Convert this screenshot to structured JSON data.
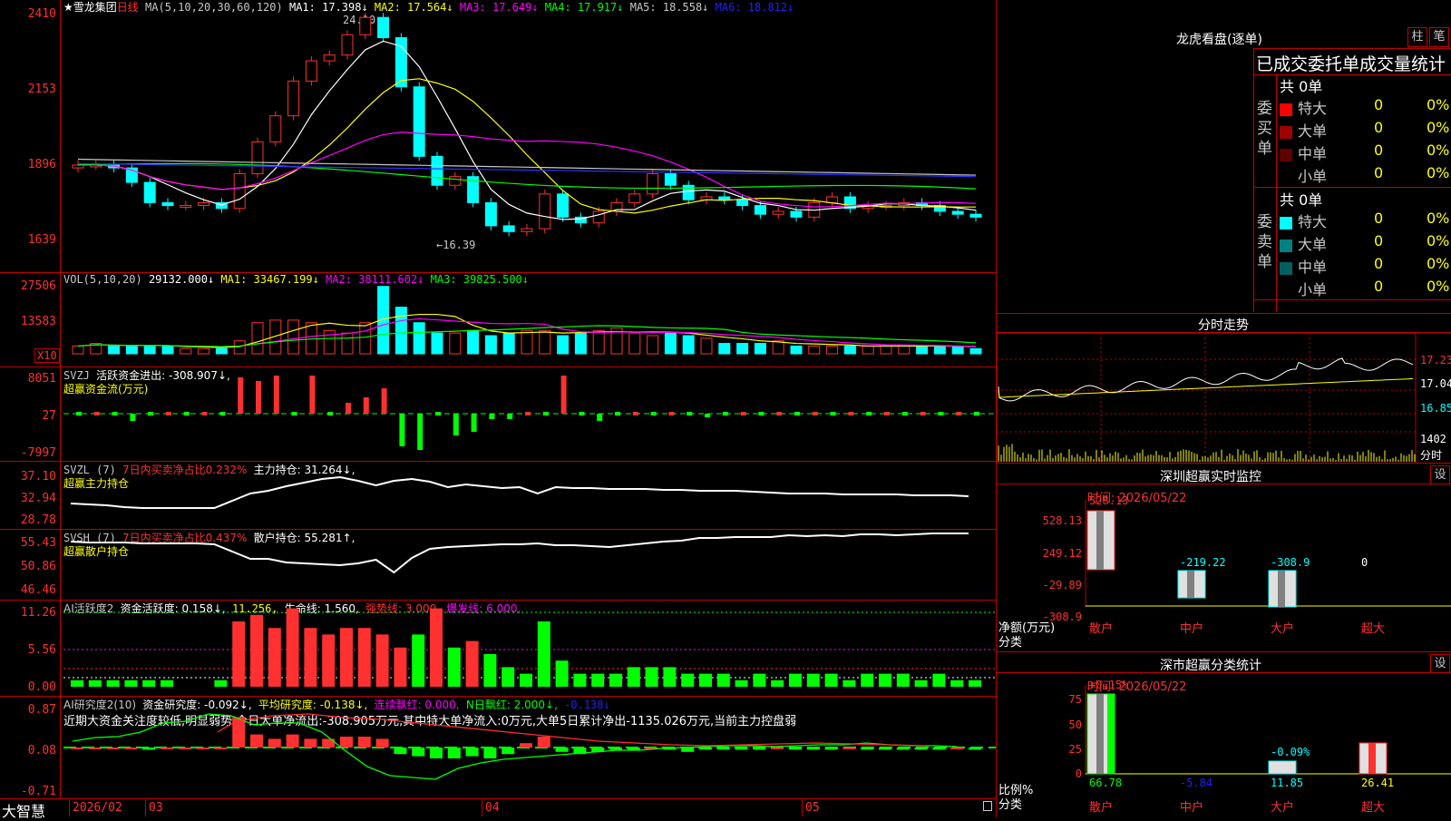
{
  "header": {
    "stock_name": "★雪龙集团",
    "period": "日线",
    "ma_params": "MA(5,10,20,30,60,120)",
    "ma1": "MA1: 17.398↓",
    "ma2": "MA2: 17.564↓",
    "ma3": "MA3: 17.649↓",
    "ma4": "MA4: 17.917↓",
    "ma5": "MA5: 18.558↓",
    "ma6": "MA6: 18.812↓",
    "high_mark": "24.10",
    "low_mark": "←16.39",
    "y_ticks": [
      "2410",
      "2153",
      "1896",
      "1639"
    ]
  },
  "vol_panel": {
    "label": "VOL(5,10,20)",
    "value": "29132.000↓",
    "ma1": "MA1: 33467.199↓",
    "ma2": "MA2: 38111.602↓",
    "ma3": "MA3: 39825.500↓",
    "y_ticks": [
      "27506",
      "13583"
    ],
    "unit": "X10"
  },
  "svzj_panel": {
    "label": "SVZJ",
    "line1": "活跃资金进出: -308.907↓,",
    "line2": "超赢资金流(万元)",
    "y_ticks": [
      "8051",
      "27",
      "-7997"
    ]
  },
  "svzl_panel": {
    "label": "SVZL (7)",
    "part1": "7日内买卖净占比0.232%",
    "part2": "主力持仓: 31.264↓,",
    "line2": "超赢主力持仓",
    "y_ticks": [
      "37.10",
      "32.94",
      "28.78"
    ]
  },
  "svsh_panel": {
    "label": "SVSH (7)",
    "part1": "7日内买卖净占比0.437%",
    "part2": "散户持仓: 55.281↑,",
    "line2": "超赢散户持仓",
    "y_ticks": [
      "55.43",
      "50.86",
      "46.46"
    ]
  },
  "ai1_panel": {
    "label": "AI活跃度2",
    "v1": "资金活跃度: 0.158↓,",
    "v2": "11.256,",
    "v3": "生命线: 1.560,",
    "v4": "强势线: 3.000,",
    "v5": "爆发线: 6.000,",
    "y_ticks": [
      "11.26",
      "5.56",
      "0.00"
    ]
  },
  "ai2_panel": {
    "label": "AI研究度2(10)",
    "v1": "资金研究度: -0.092↓,",
    "v2": "平均研究度: -0.138↓,",
    "v3": "连续飘红: 0.000,",
    "v4": "N日飘红: 2.000↓,",
    "v5": "-0.138↓",
    "summary": "近期大资金关注度较低,明显弱势,今日大单净流出:-308.905万元,其中特大单净流入:0万元,大单5日累计净出-1135.026万元,当前主力控盘弱",
    "y_ticks": [
      "0.87",
      "0.08",
      "-0.71"
    ]
  },
  "footer": {
    "brand": "大智慧",
    "date": "2026/02",
    "m1": "03",
    "m2": "04",
    "m3": "05"
  },
  "lhb": {
    "title": "龙虎看盘(逐单)",
    "btn1": "柱",
    "btn2": "笔",
    "subtitle": "已成交委托单成交量统计",
    "buy_group": "委买单",
    "buy_total": "共 0单",
    "sell_group": "委卖单",
    "sell_total": "共 0单",
    "buy_rows": [
      {
        "label": "特大",
        "count": "0",
        "pct": "0%",
        "color": "#ff0000"
      },
      {
        "label": "大单",
        "count": "0",
        "pct": "0%",
        "color": "#a00000"
      },
      {
        "label": "中单",
        "count": "0",
        "pct": "0%",
        "color": "#600000"
      },
      {
        "label": "小单",
        "count": "0",
        "pct": "0%",
        "color": "#000000"
      }
    ],
    "sell_rows": [
      {
        "label": "特大",
        "count": "0",
        "pct": "0%",
        "color": "#00ffff"
      },
      {
        "label": "大单",
        "count": "0",
        "pct": "0%",
        "color": "#008080"
      },
      {
        "label": "中单",
        "count": "0",
        "pct": "0%",
        "color": "#006060"
      },
      {
        "label": "小单",
        "count": "0",
        "pct": "0%",
        "color": "#000000"
      }
    ]
  },
  "intraday": {
    "title": "分时走势",
    "ticks": [
      "17.23",
      "17.04",
      "16.85"
    ],
    "vol_tick": "1402",
    "vol_unit": "分时"
  },
  "sz_monitor": {
    "title": "深圳超赢实时监控",
    "btn": "设",
    "time": "时间: 2026/05/22",
    "y_ticks": [
      "528.13",
      "249.12",
      "-29.89",
      "-308.9"
    ],
    "y_label": "净额(万元)",
    "x_label": "分类",
    "cats": [
      "散户",
      "中户",
      "大户",
      "超大"
    ],
    "values": [
      "528.13",
      "-219.22",
      "-308.9",
      "0"
    ]
  },
  "sz_stats": {
    "title": "深市超赢分类统计",
    "btn": "设",
    "time": "时间: 2026/05/22",
    "y_ticks": [
      "75",
      "50",
      "25",
      "0"
    ],
    "y_label": "比例%",
    "x_label": "分类",
    "cats": [
      "散户",
      "中户",
      "大户",
      "超大"
    ],
    "top_labels": [
      "+0.15%",
      "-0.09%"
    ],
    "values": [
      "66.78",
      "-5.84",
      "11.85",
      "26.41"
    ]
  }
}
